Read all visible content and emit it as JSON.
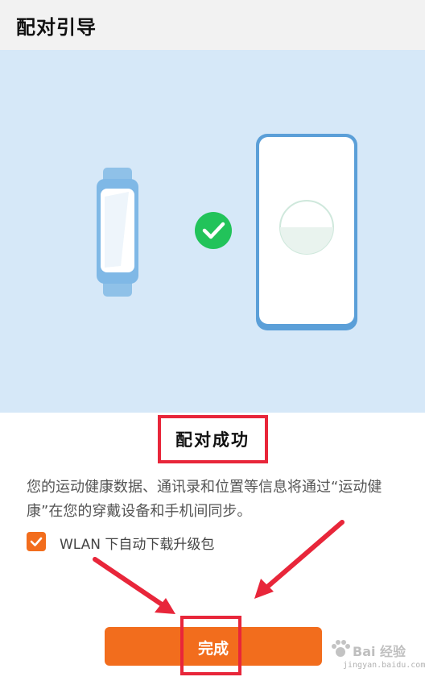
{
  "header": {
    "title": "配对引导"
  },
  "status": {
    "title": "配对成功"
  },
  "description": "您的运动健康数据、通讯录和位置等信息将通过“运动健康”在您的穿戴设备和手机间同步。",
  "wlan_option": {
    "label": "WLAN 下自动下载升级包",
    "checked": true
  },
  "done_button": {
    "label": "完成"
  },
  "colors": {
    "accent": "#f26d1d",
    "annotation": "#e8263a",
    "check": "#22c35a",
    "illustration_bg": "#d6e8f8"
  },
  "watermark": {
    "text": "Bai 经验",
    "url": "jingyan.baidu.com"
  }
}
